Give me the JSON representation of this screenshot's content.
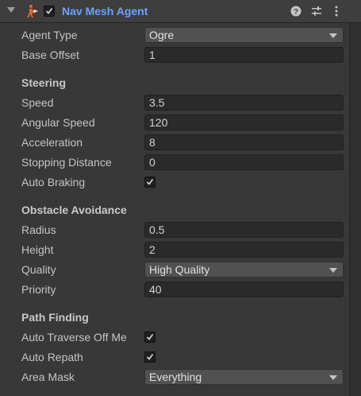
{
  "header": {
    "title": "Nav Mesh Agent",
    "enabled": true,
    "icons": [
      "foldout-arrow-icon",
      "nav-mesh-agent-icon",
      "help-icon",
      "presets-icon",
      "menu-kebab-icon"
    ]
  },
  "rows": {
    "agent_type": {
      "label": "Agent Type",
      "value": "Ogre"
    },
    "base_offset": {
      "label": "Base Offset",
      "value": "1"
    }
  },
  "steering": {
    "title": "Steering",
    "speed": {
      "label": "Speed",
      "value": "3.5"
    },
    "angular_speed": {
      "label": "Angular Speed",
      "value": "120"
    },
    "acceleration": {
      "label": "Acceleration",
      "value": "8"
    },
    "stopping_distance": {
      "label": "Stopping Distance",
      "value": "0"
    },
    "auto_braking": {
      "label": "Auto Braking",
      "checked": true
    }
  },
  "obstacle_avoidance": {
    "title": "Obstacle Avoidance",
    "radius": {
      "label": "Radius",
      "value": "0.5"
    },
    "height": {
      "label": "Height",
      "value": "2"
    },
    "quality": {
      "label": "Quality",
      "value": "High Quality"
    },
    "priority": {
      "label": "Priority",
      "value": "40"
    }
  },
  "path_finding": {
    "title": "Path Finding",
    "auto_traverse": {
      "label": "Auto Traverse Off Me",
      "checked": true
    },
    "auto_repath": {
      "label": "Auto Repath",
      "checked": true
    },
    "area_mask": {
      "label": "Area Mask",
      "value": "Everything"
    }
  },
  "colors": {
    "background": "#383838",
    "header": "#3e3e3e",
    "title": "#6aa2ff",
    "field": "#2a2a2a",
    "dropdown": "#515151",
    "icon_orange": "#e8642a"
  }
}
